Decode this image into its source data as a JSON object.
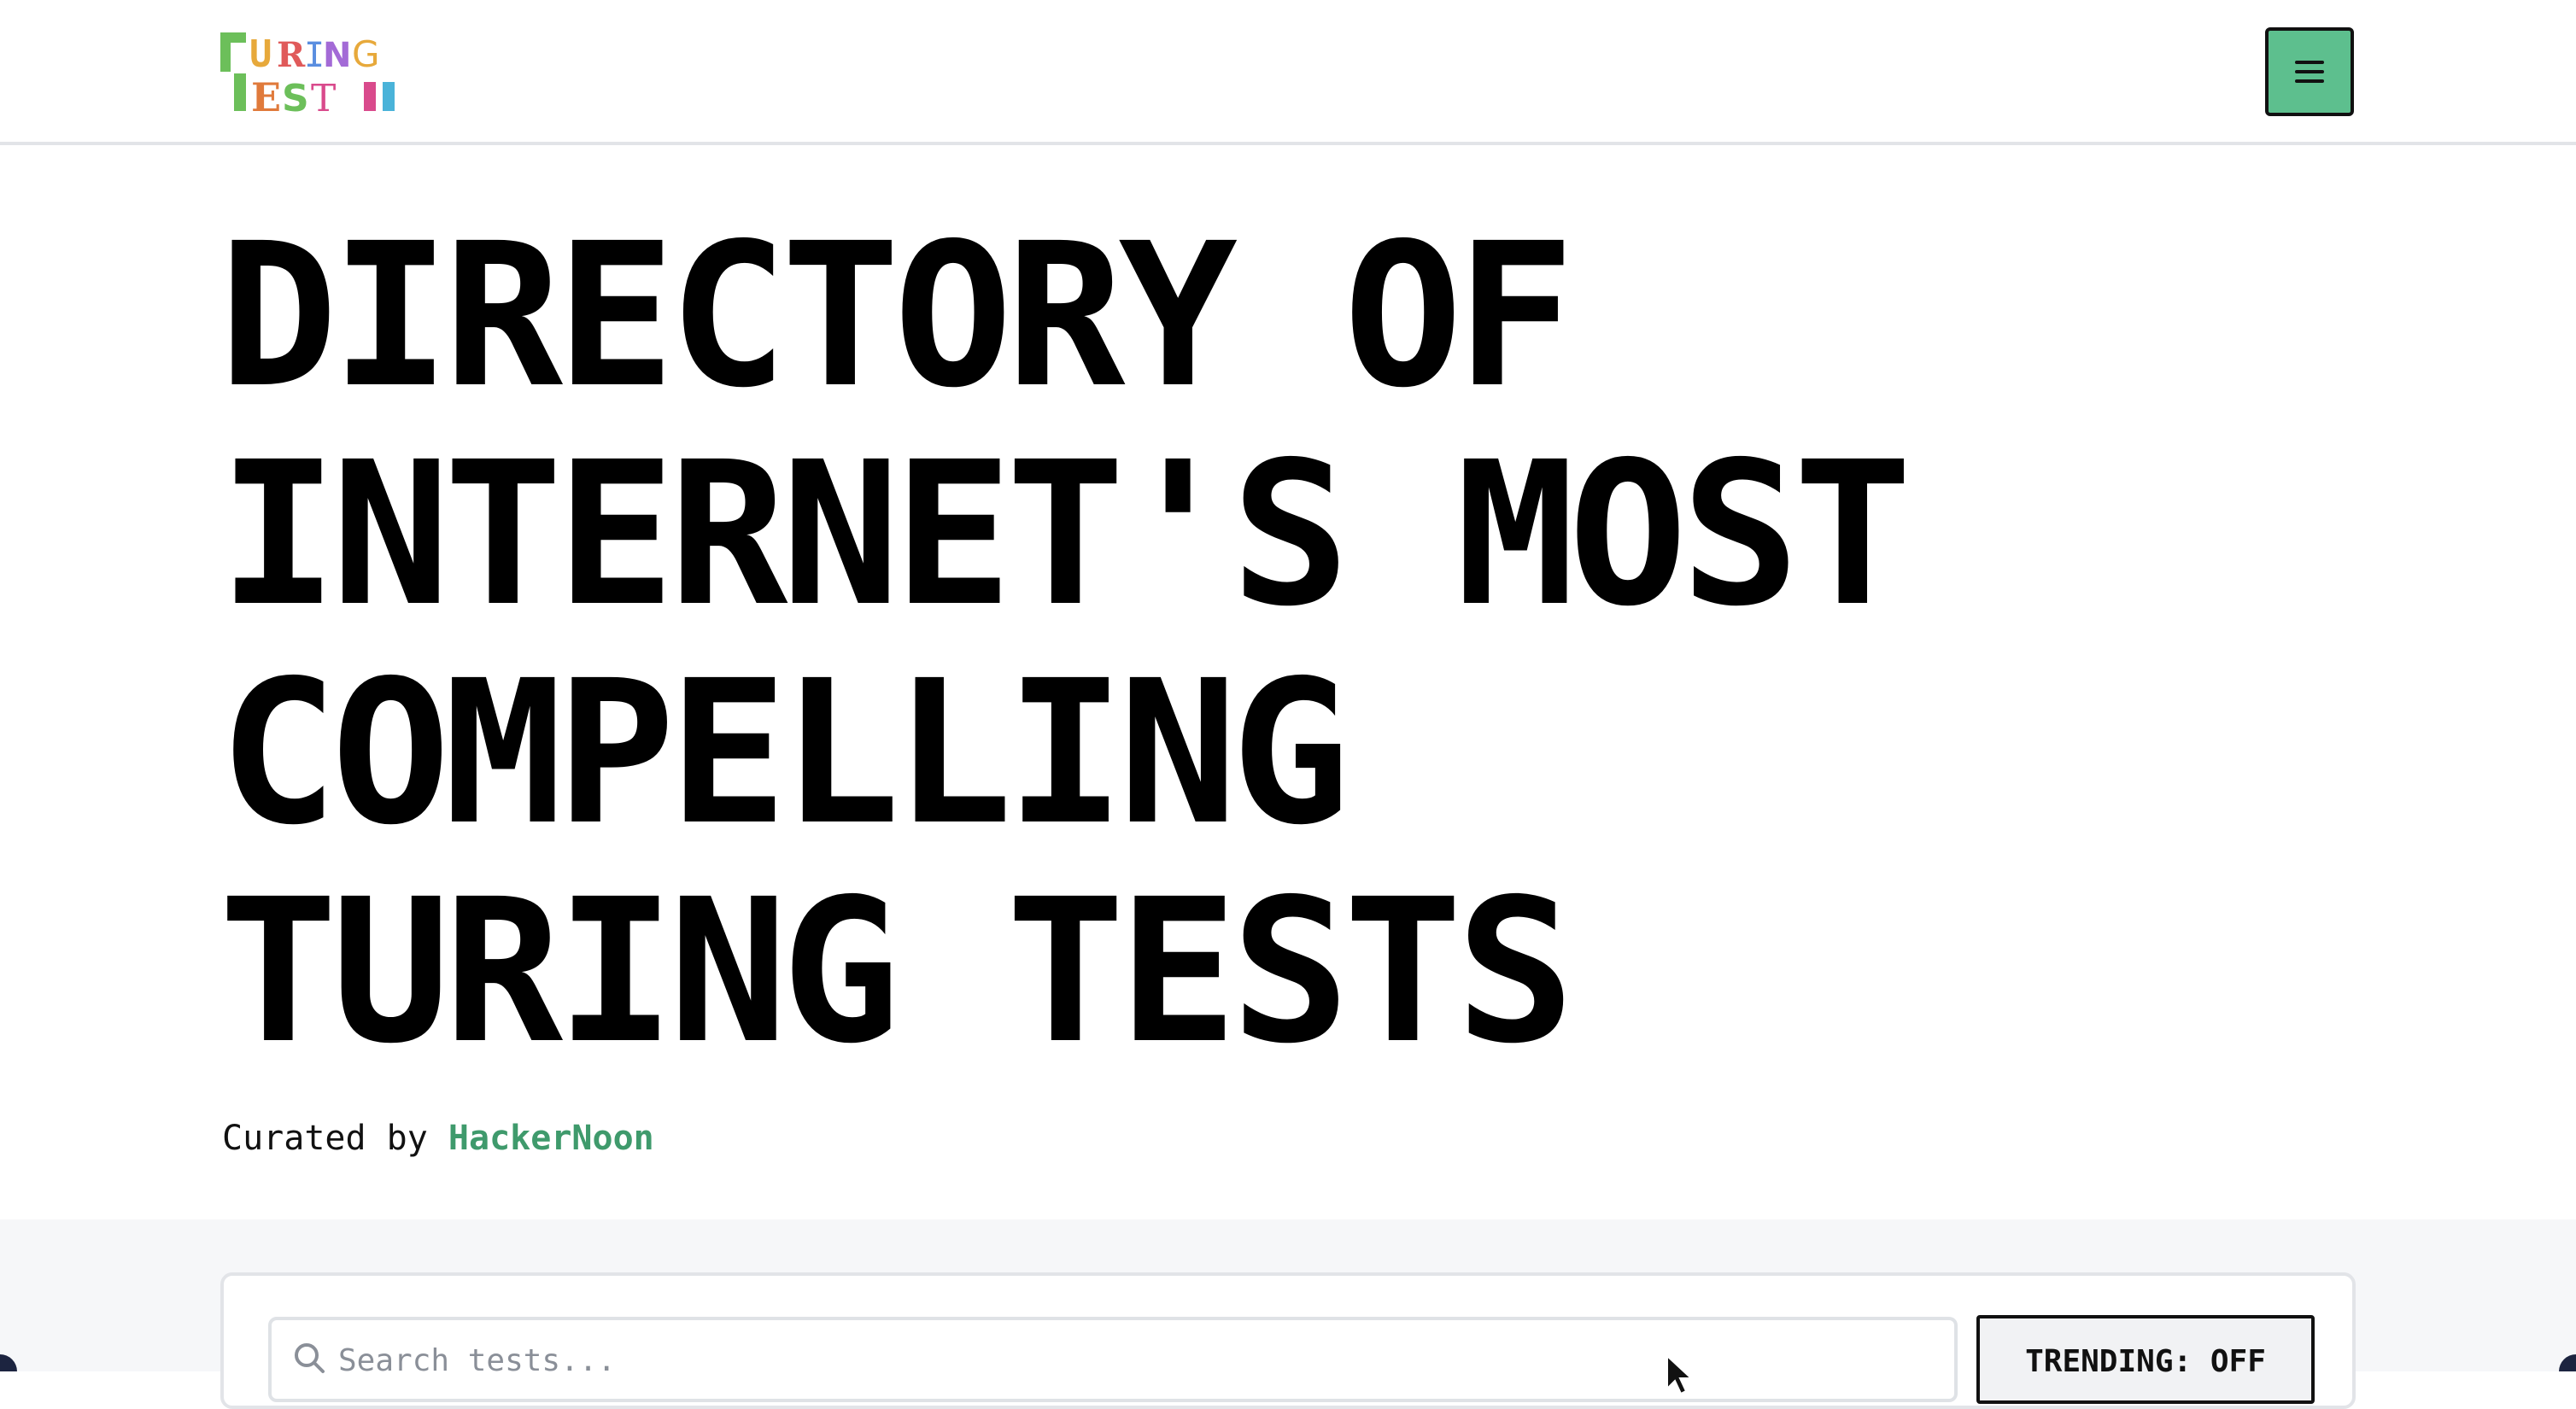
{
  "header": {
    "logo": {
      "letters_top": [
        "T",
        "U",
        "R",
        "I",
        "N",
        "G"
      ],
      "letters_bottom": [
        "T",
        "E",
        "S",
        "T"
      ],
      "colors": [
        "#6cbf5a",
        "#e7a93b",
        "#e05a5a",
        "#5a8ee0",
        "#a36ad6",
        "#e7a93b",
        "#e07a3b",
        "#6cbf5a",
        "#d94a8c",
        "#4ab3d9"
      ],
      "icon": "turing-test-logo"
    },
    "menu_button": {
      "icon": "hamburger-menu-icon",
      "color": "#5dbf8e"
    }
  },
  "hero": {
    "title_lines": [
      "DIRECTORY OF",
      "INTERNET'S MOST",
      "COMPELLING",
      "TURING TESTS"
    ],
    "curated_prefix": "Curated by",
    "curated_link": "HackerNoon",
    "link_color": "#3f9a6c"
  },
  "controls": {
    "search": {
      "placeholder": "Search tests...",
      "value": "",
      "icon": "search-icon"
    },
    "trending_toggle": {
      "label": "TRENDING: OFF"
    },
    "cursor_icon": "mouse-pointer-icon"
  }
}
